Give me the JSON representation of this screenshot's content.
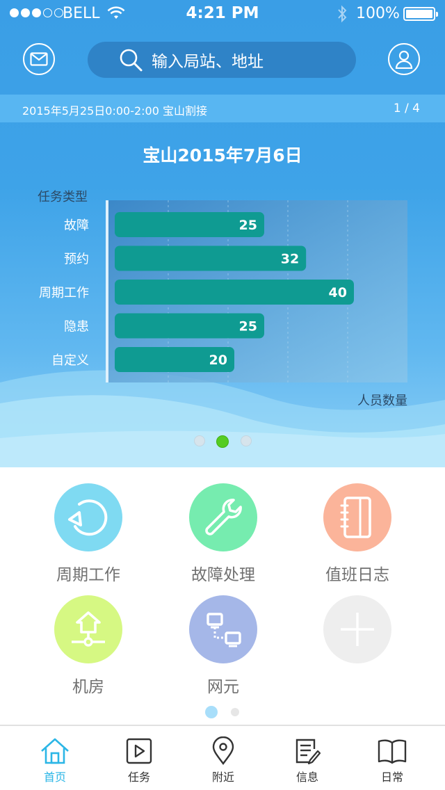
{
  "status_bar": {
    "carrier": "BELL",
    "time": "4:21 PM",
    "battery": "100%",
    "signal_bars": 3,
    "signal_total": 5
  },
  "header": {
    "search_placeholder": "输入局站、地址",
    "left_icon": "mail-icon",
    "right_icon": "user-icon"
  },
  "notice": {
    "message": "2015年5月25日0:00-2:00  宝山割接",
    "page": "1 / 4"
  },
  "chart_data": {
    "type": "bar",
    "orientation": "horizontal",
    "title": "宝山2015年7月6日",
    "ylabel": "任务类型",
    "xlabel": "人员数量",
    "categories": [
      "故障",
      "预约",
      "周期工作",
      "隐患",
      "自定义"
    ],
    "values": [
      25,
      32,
      40,
      25,
      20
    ],
    "xlim": [
      0,
      50
    ],
    "grid": true,
    "bar_color": "#0f9b92"
  },
  "carousel": {
    "count": 3,
    "active": 1
  },
  "grid": {
    "items": [
      {
        "label": "周期工作",
        "icon": "cycle-icon",
        "color": "#7fdaf2"
      },
      {
        "label": "故障处理",
        "icon": "wrench-icon",
        "color": "#76ecaf"
      },
      {
        "label": "值班日志",
        "icon": "notebook-icon",
        "color": "#fbb49a"
      },
      {
        "label": "机房",
        "icon": "house-network-icon",
        "color": "#d6f883"
      },
      {
        "label": "网元",
        "icon": "network-element-icon",
        "color": "#a5b7e8"
      },
      {
        "label": "",
        "icon": "add-icon",
        "color": "#eeeeee"
      }
    ],
    "pages": 2,
    "active_page": 0
  },
  "tabbar": {
    "active_color": "#2bb6e6",
    "tabs": [
      {
        "label": "首页",
        "icon": "home-icon",
        "active": true
      },
      {
        "label": "任务",
        "icon": "play-icon",
        "active": false
      },
      {
        "label": "附近",
        "icon": "location-pin-icon",
        "active": false
      },
      {
        "label": "信息",
        "icon": "edit-document-icon",
        "active": false
      },
      {
        "label": "日常",
        "icon": "book-icon",
        "active": false
      }
    ]
  }
}
